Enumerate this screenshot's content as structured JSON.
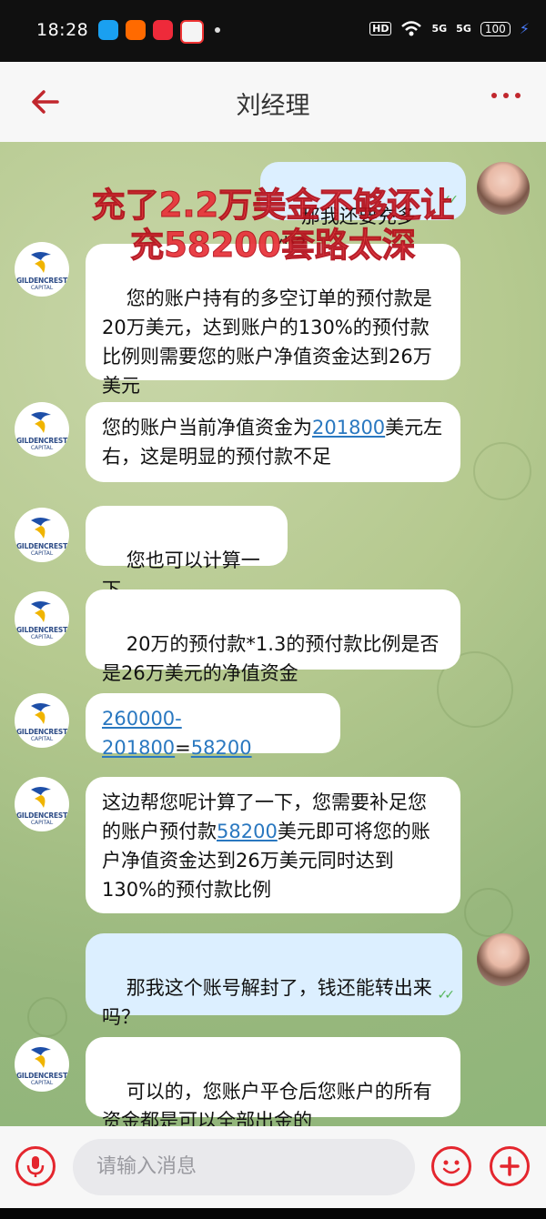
{
  "status_bar": {
    "time": "18:28",
    "hd": "HD",
    "signal1": "5G",
    "signal2": "5G",
    "battery": "100"
  },
  "header": {
    "title": "刘经理"
  },
  "overlay": {
    "line1": "充了2.2万美金不够还让",
    "line2": "充58200套路太深"
  },
  "avatar": {
    "brand_line1": "GILDENCREST",
    "brand_line2": "CAPITAL"
  },
  "messages": {
    "m1": "那我还要充多少？",
    "m2": "您的账户持有的多空订单的预付款是20万美元，达到账户的130%的预付款比例则需要您的账户净值资金达到26万美元",
    "m3a": "您的账户当前净值资金为",
    "m3b": "201800",
    "m3c": "美元左右，这是明显的预付款不足",
    "m4": "您也可以计算一下",
    "m5": "20万的预付款*1.3的预付款比例是否是26万美元的净值资金",
    "m6a": "260000-201800",
    "m6b": "=",
    "m6c": "58200",
    "m7a": "这边帮您呢计算了一下，您需要补足您的账户预付款",
    "m7b": "58200",
    "m7c": "美元即可将您的账户净值资金达到26万美元同时达到130%的预付款比例",
    "m8": "那我这个账号解封了，钱还能转出来吗？",
    "m9": "可以的，您账户平仓后您账户的所有资金都是可以全部出金的"
  },
  "input": {
    "placeholder": "请输入消息"
  },
  "colors": {
    "accent": "#e4262e",
    "incoming_bubble": "#ffffff",
    "outgoing_bubble": "#dcefff",
    "link": "#2a78c0"
  }
}
